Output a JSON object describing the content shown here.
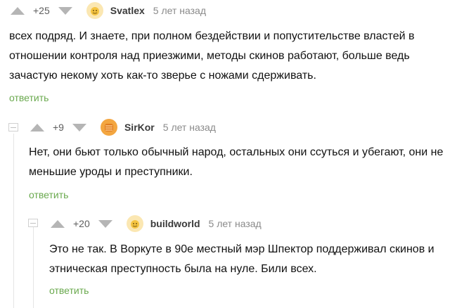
{
  "comments": [
    {
      "rating": "+25",
      "username": "Svatlex",
      "time": "5 лет назад",
      "text": "всех подряд. И знаете, при полном бездействии и попустительстве властей в отношении контроля над приезжими, методы скинов работают, больше ведь зачастую некому хоть как-то зверье с ножами сдерживать.",
      "reply_label": "ответить",
      "avatar_icon": "default-avatar-icon"
    },
    {
      "rating": "+9",
      "username": "SirKor",
      "time": "5 лет назад",
      "text": "Нет, они бьют только обычный народ, остальных они ссуться и убегают, они не меньшие уроды и преступники.",
      "reply_label": "ответить",
      "avatar_icon": "user-avatar-icon"
    },
    {
      "rating": "+20",
      "username": "buildworld",
      "time": "5 лет назад",
      "text": "Это не так. В Воркуте в 90е местный мэр Шпектор поддерживал скинов и этническая преступность была на нуле. Били всех.",
      "reply_label": "ответить",
      "avatar_icon": "default-avatar-icon"
    }
  ],
  "colors": {
    "reply_link": "#6aa94e",
    "vote_arrow": "#b5b5b5",
    "username": "#3a3a3a",
    "time": "#8a8a8a"
  }
}
